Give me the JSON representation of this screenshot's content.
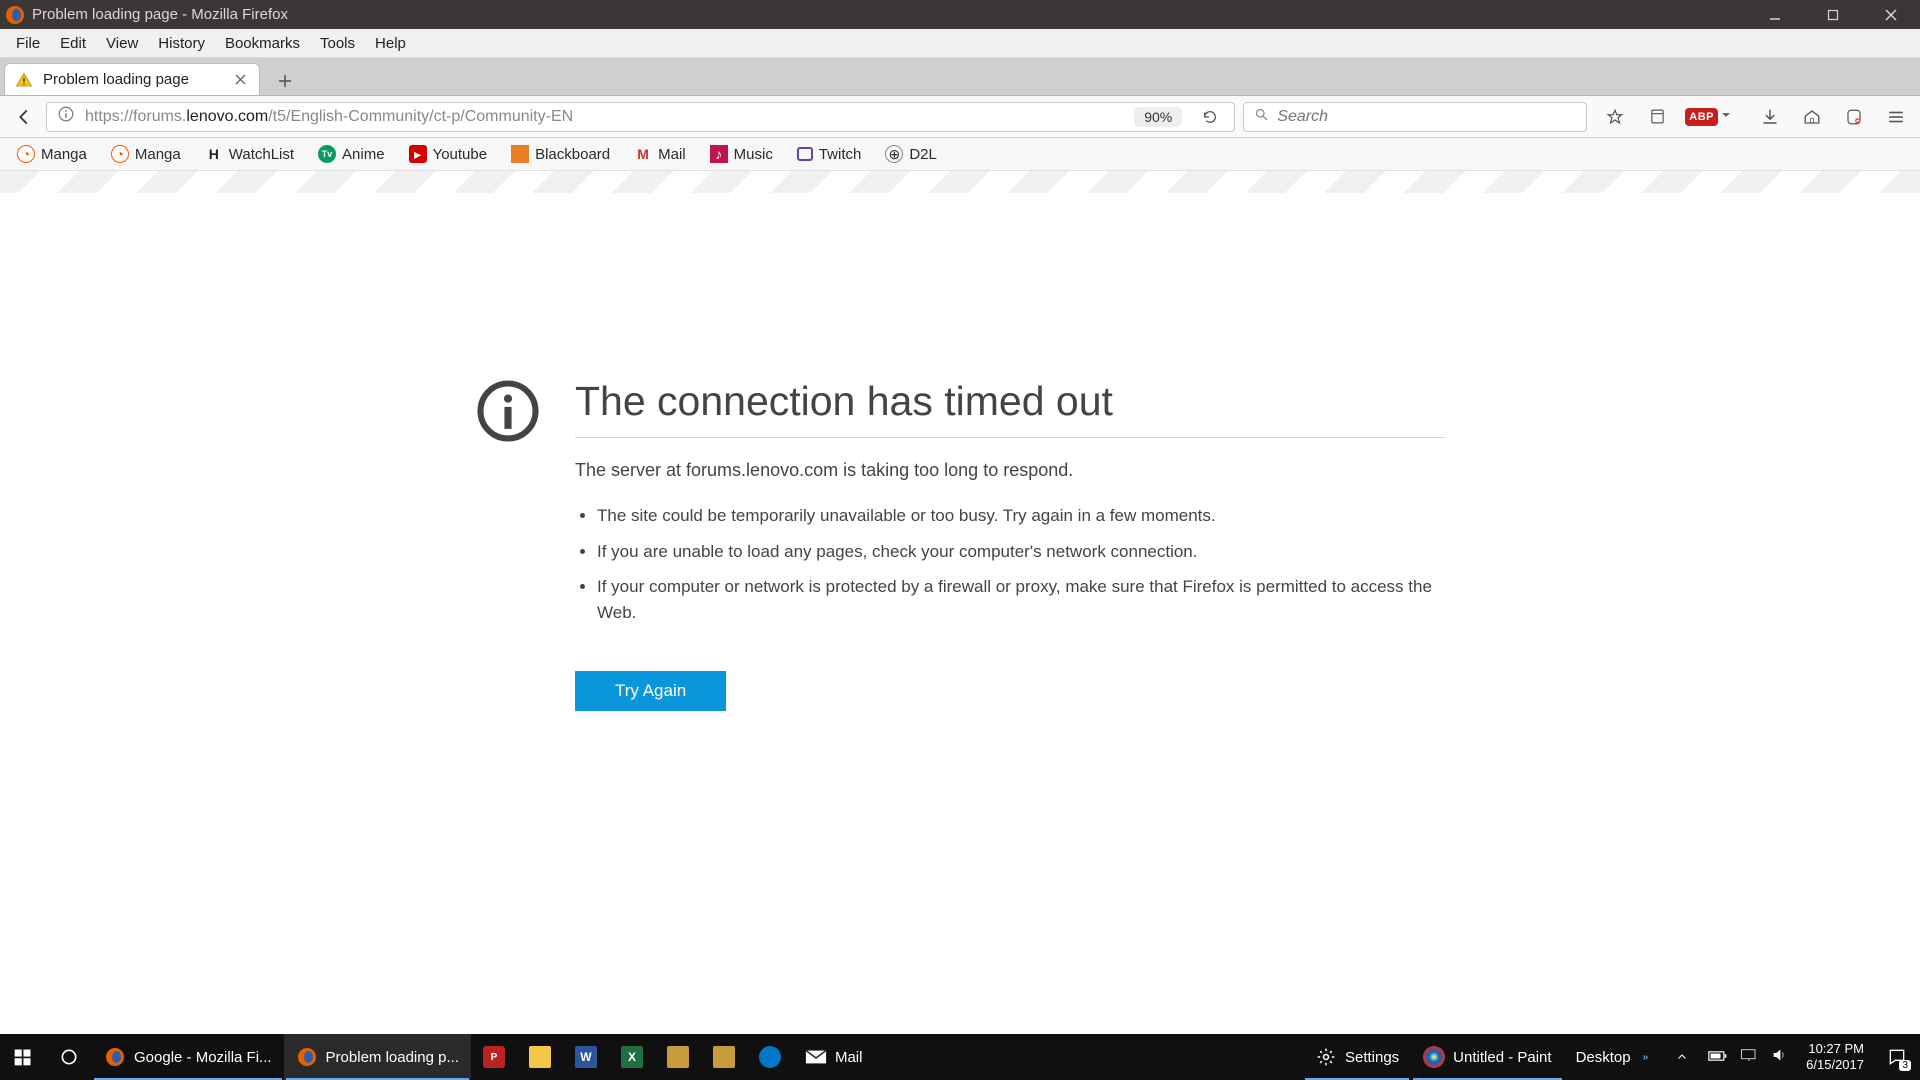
{
  "window": {
    "title": "Problem loading page - Mozilla Firefox"
  },
  "menubar": [
    "File",
    "Edit",
    "View",
    "History",
    "Bookmarks",
    "Tools",
    "Help"
  ],
  "tab": {
    "title": "Problem loading page"
  },
  "url": {
    "prefix": "https://forums.",
    "bold": "lenovo.com",
    "suffix": "/t5/English-Community/ct-p/Community-EN"
  },
  "zoom": "90%",
  "search": {
    "placeholder": "Search"
  },
  "bookmarks": [
    {
      "label": "Manga",
      "iconColor": "#ff5a00"
    },
    {
      "label": "Manga",
      "iconColor": "#ff5a00"
    },
    {
      "label": "WatchList",
      "iconColor": "#222",
      "iconText": "H"
    },
    {
      "label": "Anime",
      "iconColor": "#0a9b63",
      "iconText": "Tv"
    },
    {
      "label": "Youtube",
      "iconColor": "#d90000",
      "iconText": "▶"
    },
    {
      "label": "Blackboard",
      "iconColor": "#e67e22"
    },
    {
      "label": "Mail",
      "iconColor": "#d93025",
      "iconText": "M"
    },
    {
      "label": "Music",
      "iconColor": "#c0144c"
    },
    {
      "label": "Twitch",
      "iconColor": "#6441a5",
      "iconText": "💬"
    },
    {
      "label": "D2L",
      "iconColor": "#888",
      "iconText": "🌐"
    }
  ],
  "error": {
    "title": "The connection has timed out",
    "subtext": "The server at forums.lenovo.com is taking too long to respond.",
    "tips": [
      "The site could be temporarily unavailable or too busy. Try again in a few moments.",
      "If you are unable to load any pages, check your computer's network connection.",
      "If your computer or network is protected by a firewall or proxy, make sure that Firefox is permitted to access the Web."
    ],
    "try_again": "Try Again"
  },
  "taskbar": {
    "items": [
      {
        "label": "Google - Mozilla Fi...",
        "icon": "firefox"
      },
      {
        "label": "Problem loading p...",
        "icon": "firefox"
      },
      {
        "label": "",
        "icon": "pdf"
      },
      {
        "label": "",
        "icon": "explorer"
      },
      {
        "label": "",
        "icon": "word"
      },
      {
        "label": "",
        "icon": "excel"
      },
      {
        "label": "",
        "icon": "lol1"
      },
      {
        "label": "",
        "icon": "lol2"
      },
      {
        "label": "",
        "icon": "rocket"
      },
      {
        "label": "Mail",
        "icon": "mail"
      },
      {
        "label": "Settings",
        "icon": "gear"
      },
      {
        "label": "Untitled - Paint",
        "icon": "paint"
      }
    ],
    "desktop_label": "Desktop",
    "time": "10:27 PM",
    "date": "6/15/2017",
    "notif_count": "3"
  }
}
